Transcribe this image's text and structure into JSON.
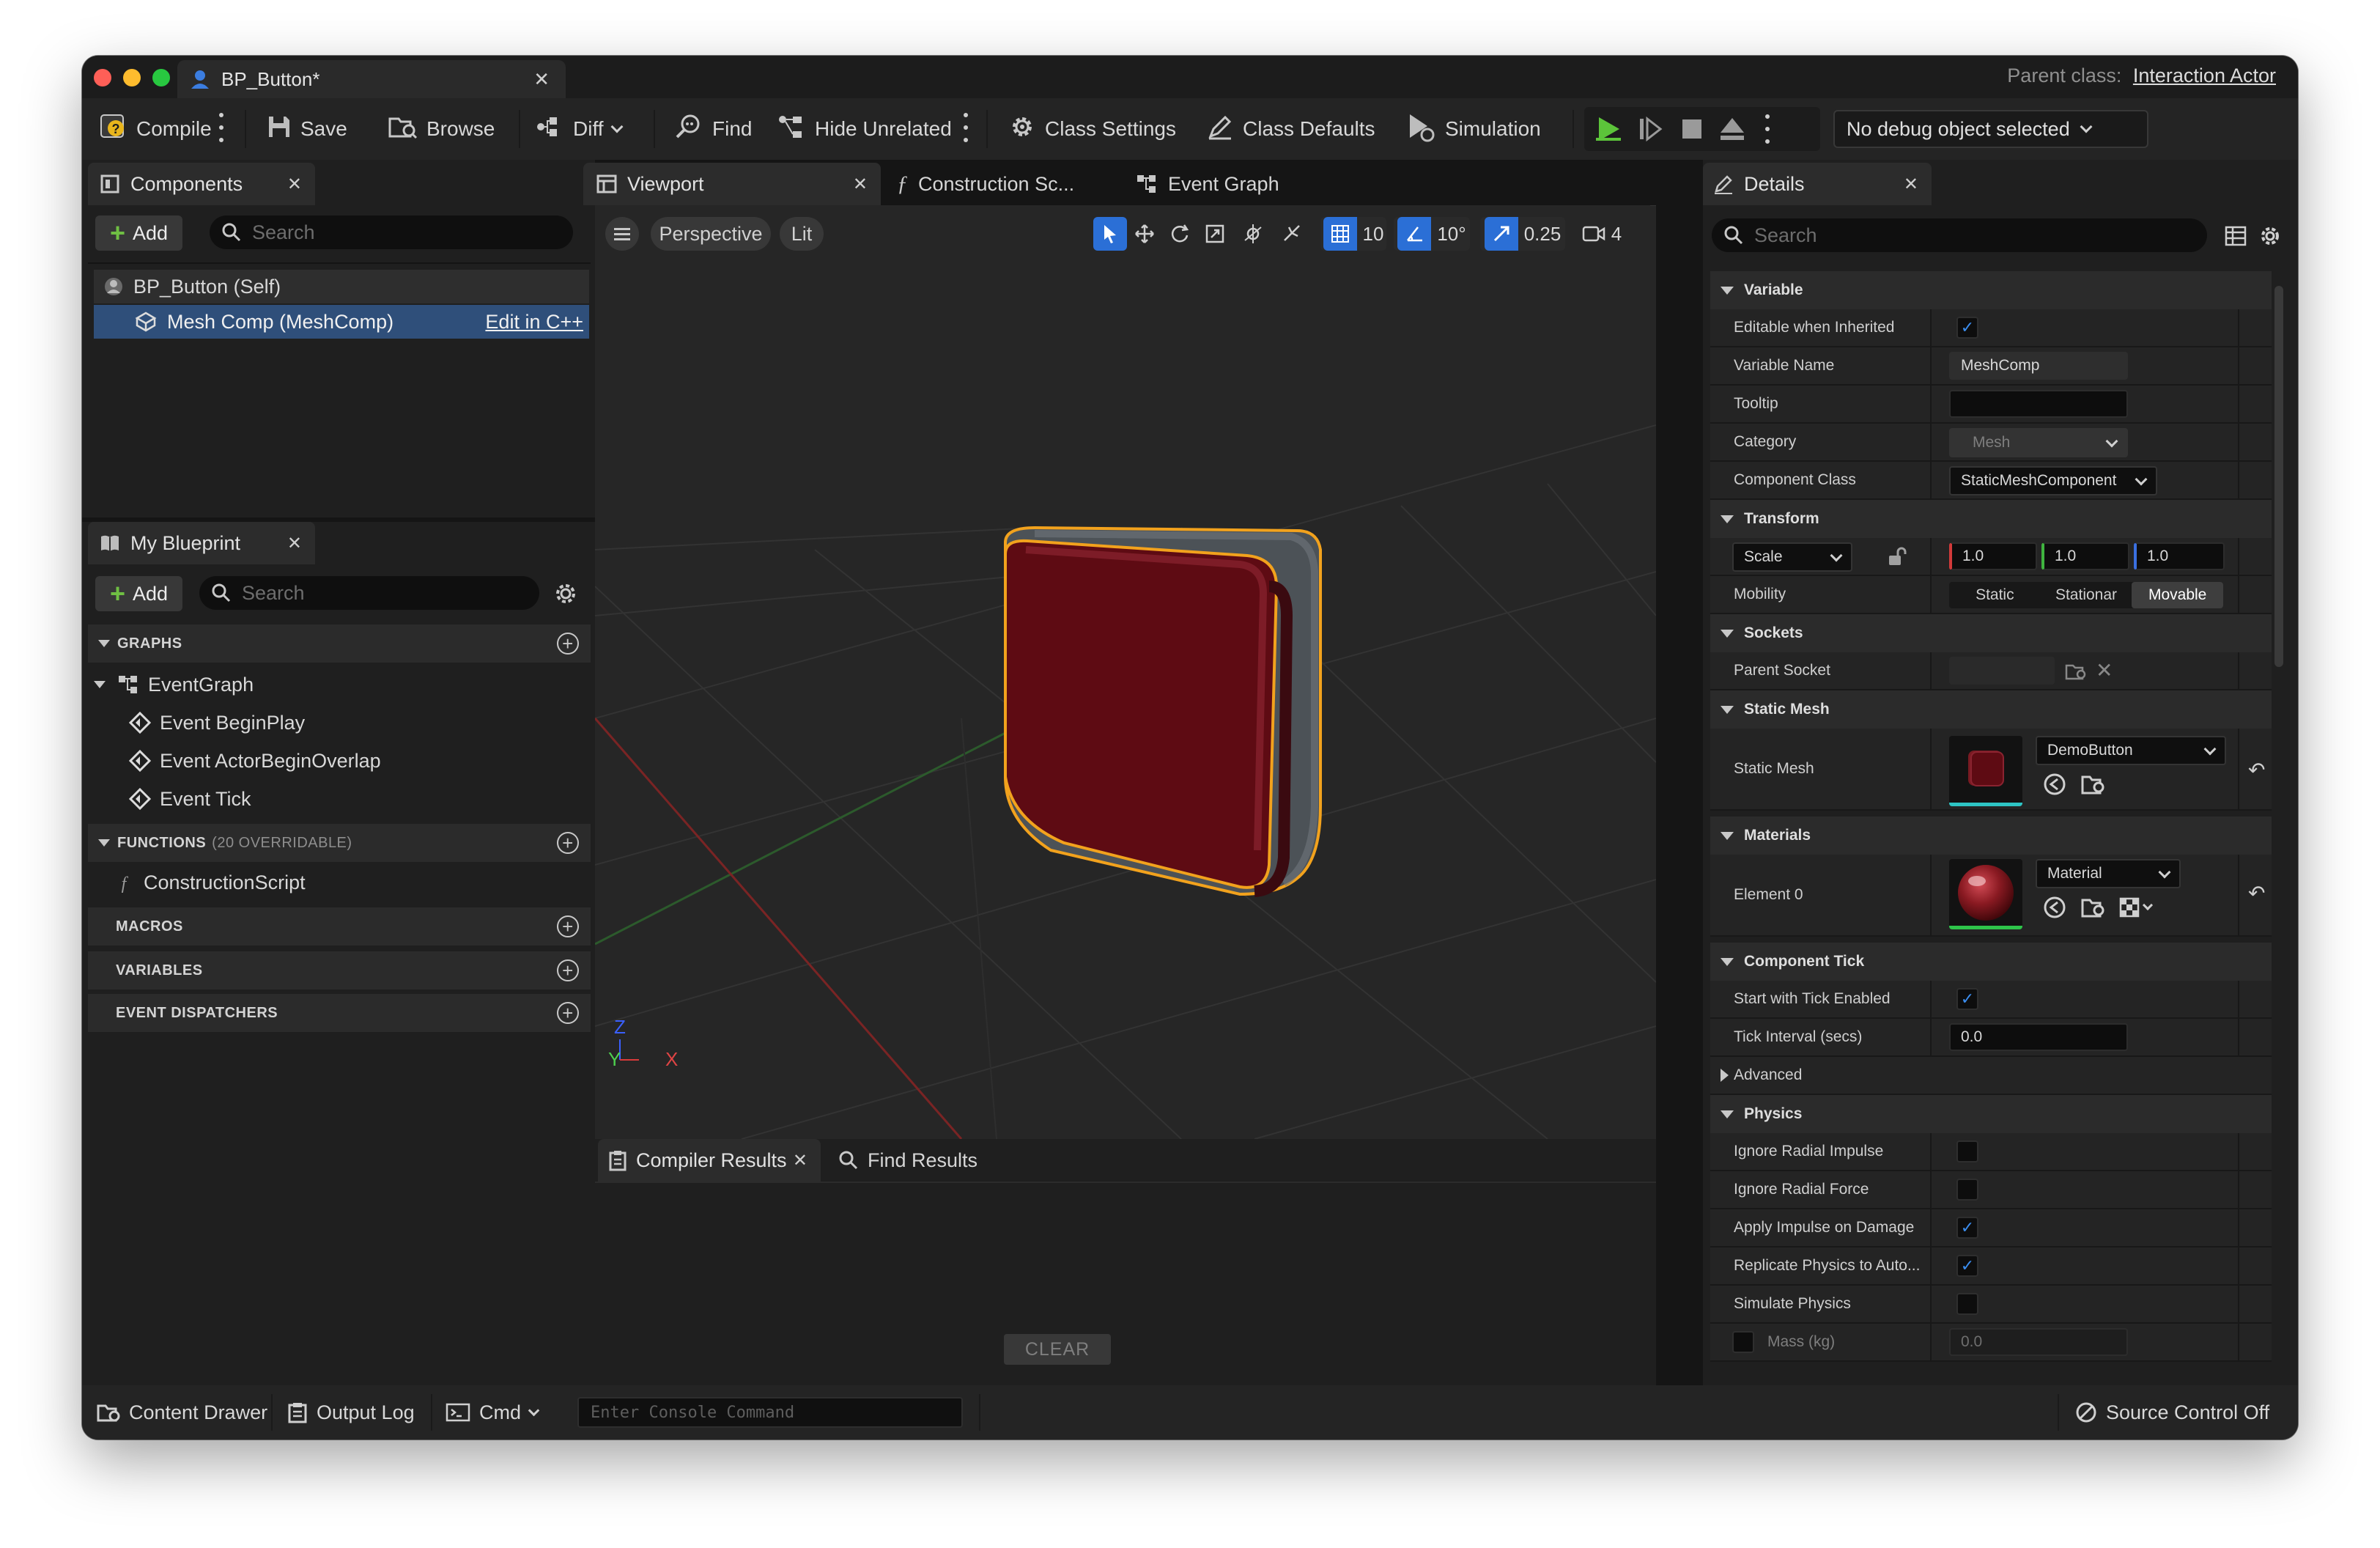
{
  "window": {
    "doc_tab": "BP_Button*",
    "parent_class_label": "Parent class:",
    "parent_class_value": "Interaction Actor"
  },
  "toolbar": {
    "compile": "Compile",
    "save": "Save",
    "browse": "Browse",
    "diff": "Diff",
    "find": "Find",
    "hide_unrelated": "Hide Unrelated",
    "class_settings": "Class Settings",
    "class_defaults": "Class Defaults",
    "simulation": "Simulation",
    "debug_object": "No debug object selected"
  },
  "components": {
    "tab": "Components",
    "add": "Add",
    "search_placeholder": "Search",
    "items": [
      {
        "label": "BP_Button (Self)"
      },
      {
        "label": "Mesh Comp (MeshComp)",
        "action": "Edit in C++"
      }
    ]
  },
  "my_blueprint": {
    "tab": "My Blueprint",
    "add": "Add",
    "search_placeholder": "Search",
    "graphs_label": "GRAPHS",
    "event_graph": "EventGraph",
    "events": [
      "Event BeginPlay",
      "Event ActorBeginOverlap",
      "Event Tick"
    ],
    "functions_label": "FUNCTIONS",
    "functions_note": "(20 OVERRIDABLE)",
    "construction_script": "ConstructionScript",
    "macros_label": "MACROS",
    "variables_label": "VARIABLES",
    "dispatchers_label": "EVENT DISPATCHERS"
  },
  "center_tabs": {
    "viewport": "Viewport",
    "construction": "Construction Sc...",
    "event_graph": "Event Graph"
  },
  "viewport": {
    "perspective": "Perspective",
    "lit": "Lit",
    "grid_snap": "10",
    "rotation_snap": "10°",
    "scale_snap": "0.25",
    "camera_speed": "4",
    "axis_z": "Z",
    "axis_y": "Y",
    "axis_x": "X"
  },
  "results": {
    "compiler_tab": "Compiler Results",
    "find_tab": "Find Results",
    "clear": "CLEAR"
  },
  "statusbar": {
    "content_drawer": "Content Drawer",
    "output_log": "Output Log",
    "cmd": "Cmd",
    "console_placeholder": "Enter Console Command",
    "source_control": "Source Control Off"
  },
  "details": {
    "tab": "Details",
    "search_placeholder": "Search",
    "sections": {
      "variable": "Variable",
      "transform": "Transform",
      "sockets": "Sockets",
      "static_mesh": "Static Mesh",
      "materials": "Materials",
      "component_tick": "Component Tick",
      "advanced": "Advanced",
      "physics": "Physics"
    },
    "rows": {
      "editable": "Editable when Inherited",
      "variable_name": "Variable Name",
      "variable_name_value": "MeshComp",
      "tooltip": "Tooltip",
      "category": "Category",
      "category_value": "Mesh",
      "component_class": "Component Class",
      "component_class_value": "StaticMeshComponent",
      "scale": "Scale",
      "scale_x": "1.0",
      "scale_y": "1.0",
      "scale_z": "1.0",
      "mobility": "Mobility",
      "mobility_options": [
        "Static",
        "Stationar",
        "Movable"
      ],
      "parent_socket": "Parent Socket",
      "static_mesh": "Static Mesh",
      "static_mesh_value": "DemoButton",
      "element0": "Element 0",
      "material_value": "Material",
      "start_tick": "Start with Tick Enabled",
      "tick_interval": "Tick Interval (secs)",
      "tick_interval_value": "0.0",
      "ignore_radial_impulse": "Ignore Radial Impulse",
      "ignore_radial_force": "Ignore Radial Force",
      "apply_impulse": "Apply Impulse on Damage",
      "replicate_physics": "Replicate Physics to Auto...",
      "simulate_physics": "Simulate Physics",
      "mass": "Mass (kg)",
      "mass_value": "0.0"
    },
    "checks": {
      "editable": true,
      "start_tick": true,
      "ignore_radial_impulse": false,
      "ignore_radial_force": false,
      "apply_impulse": true,
      "replicate_physics": true,
      "simulate_physics": false,
      "mass": false
    }
  },
  "colors": {
    "accent_blue": "#2b6fd6",
    "selection": "#2f4f7a",
    "play_green": "#5cc43a",
    "outline_orange": "#f2a21d",
    "button_red": "#6b0c14"
  }
}
